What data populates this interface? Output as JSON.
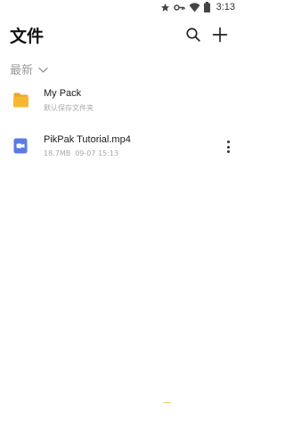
{
  "status_bar": {
    "time": "3:13",
    "icons": [
      "star-icon",
      "key-icon",
      "wifi-icon",
      "battery-icon"
    ]
  },
  "header": {
    "title": "文件",
    "icons": [
      "search-icon",
      "plus-icon"
    ]
  },
  "sort": {
    "label": "最新",
    "icon": "chevron-down-icon"
  },
  "files": [
    {
      "name": "My Pack",
      "subtitle": "默认保存文件夹",
      "icon": "folder-icon",
      "icon_color": "#F7B731"
    },
    {
      "name": "PikPak Tutorial.mp4",
      "size": "18.7MB",
      "date": "09-07 15:13",
      "icon": "video-file-icon",
      "icon_color": "#5B7BE3"
    }
  ]
}
